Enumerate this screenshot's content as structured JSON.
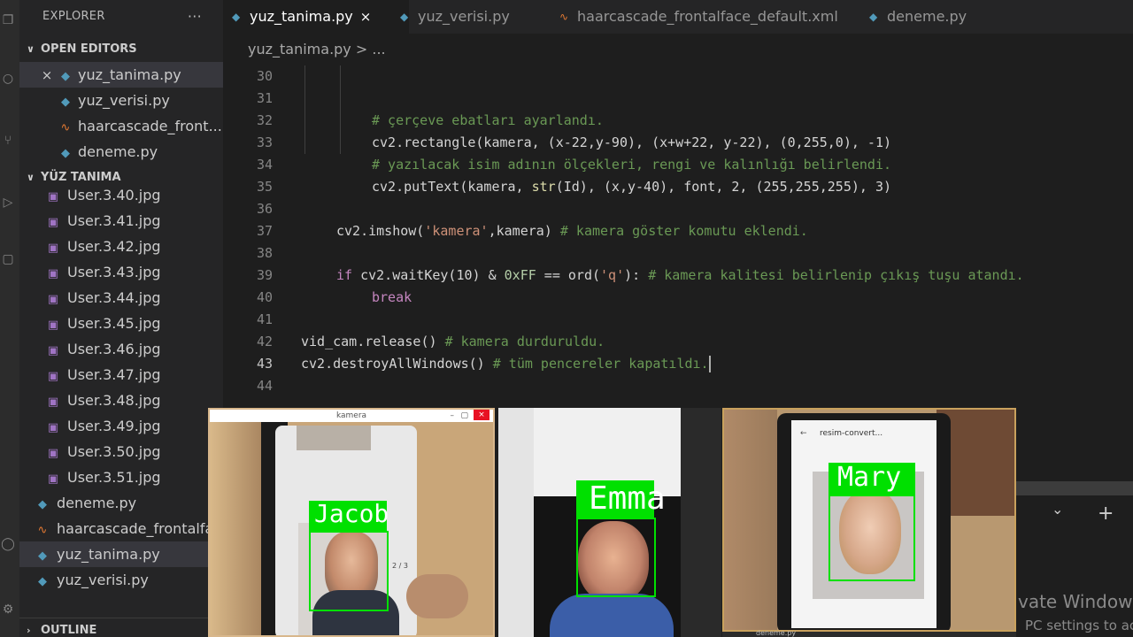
{
  "sidebar": {
    "title": "EXPLORER",
    "more": "···",
    "open_editors_label": "OPEN EDITORS",
    "open_editors": [
      {
        "name": "yuz_tanima.py",
        "kind": "py",
        "active": true
      },
      {
        "name": "yuz_verisi.py",
        "kind": "py"
      },
      {
        "name": "haarcascade_front...",
        "kind": "xml"
      },
      {
        "name": "deneme.py",
        "kind": "py"
      }
    ],
    "folder_label": "YÜZ TANIMA",
    "files": [
      {
        "name": "User.3.40.jpg",
        "kind": "img"
      },
      {
        "name": "User.3.41.jpg",
        "kind": "img"
      },
      {
        "name": "User.3.42.jpg",
        "kind": "img"
      },
      {
        "name": "User.3.43.jpg",
        "kind": "img"
      },
      {
        "name": "User.3.44.jpg",
        "kind": "img"
      },
      {
        "name": "User.3.45.jpg",
        "kind": "img"
      },
      {
        "name": "User.3.46.jpg",
        "kind": "img"
      },
      {
        "name": "User.3.47.jpg",
        "kind": "img"
      },
      {
        "name": "User.3.48.jpg",
        "kind": "img"
      },
      {
        "name": "User.3.49.jpg",
        "kind": "img"
      },
      {
        "name": "User.3.50.jpg",
        "kind": "img"
      },
      {
        "name": "User.3.51.jpg",
        "kind": "img"
      },
      {
        "name": "deneme.py",
        "kind": "py"
      },
      {
        "name": "haarcascade_frontalface",
        "kind": "xml"
      },
      {
        "name": "yuz_tanima.py",
        "kind": "py",
        "active": true
      },
      {
        "name": "yuz_verisi.py",
        "kind": "py"
      }
    ],
    "outline_label": "OUTLINE"
  },
  "tabs": [
    {
      "name": "yuz_tanima.py",
      "kind": "py",
      "active": true
    },
    {
      "name": "yuz_verisi.py",
      "kind": "py"
    },
    {
      "name": "haarcascade_frontalface_default.xml",
      "kind": "xml"
    },
    {
      "name": "deneme.py",
      "kind": "py"
    }
  ],
  "breadcrumb": {
    "file": "yuz_tanima.py",
    "sep": ">",
    "rest": "..."
  },
  "editor": {
    "current_line": "43",
    "lines": [
      {
        "n": "30",
        "segs": []
      },
      {
        "n": "31",
        "segs": []
      },
      {
        "n": "32",
        "indent": 2,
        "segs": [
          {
            "t": "# çerçeve ebatları ayarlandı.",
            "c": "cm"
          }
        ]
      },
      {
        "n": "33",
        "indent": 2,
        "segs": [
          {
            "t": "cv2.rectangle(kamera, (x-22,y-90), (x+w+22, y-22), (0,255,0), -1)"
          }
        ]
      },
      {
        "n": "34",
        "indent": 2,
        "segs": [
          {
            "t": "# yazılacak isim adının ölçekleri, rengi ve kalınlığı belirlendi.",
            "c": "cm"
          }
        ]
      },
      {
        "n": "35",
        "indent": 2,
        "segs": [
          {
            "t": "cv2.putText(kamera, "
          },
          {
            "t": "str",
            "c": "fn"
          },
          {
            "t": "(Id), (x,y-40), font, 2, (255,255,255), 3)"
          }
        ]
      },
      {
        "n": "36",
        "segs": []
      },
      {
        "n": "37",
        "indent": 1,
        "segs": [
          {
            "t": "cv2.imshow("
          },
          {
            "t": "'kamera'",
            "c": "str"
          },
          {
            "t": ",kamera) "
          },
          {
            "t": "# kamera göster komutu eklendi.",
            "c": "cm"
          }
        ]
      },
      {
        "n": "38",
        "segs": []
      },
      {
        "n": "39",
        "indent": 1,
        "segs": [
          {
            "t": "if",
            "c": "kw"
          },
          {
            "t": " cv2.waitKey(10) & "
          },
          {
            "t": "0xFF",
            "c": "hex"
          },
          {
            "t": " == ord("
          },
          {
            "t": "'q'",
            "c": "str"
          },
          {
            "t": "): "
          },
          {
            "t": "# kamera kalitesi belirlenip çıkış tuşu atandı.",
            "c": "cm"
          }
        ]
      },
      {
        "n": "40",
        "indent": 2,
        "segs": [
          {
            "t": "break",
            "c": "kw"
          }
        ]
      },
      {
        "n": "41",
        "segs": []
      },
      {
        "n": "42",
        "indent": 0,
        "segs": [
          {
            "t": "vid_cam.release() "
          },
          {
            "t": "# kamera durduruldu.",
            "c": "cm"
          }
        ]
      },
      {
        "n": "43",
        "indent": 0,
        "caret": true,
        "segs": [
          {
            "t": "cv2.destroyAllWindows() "
          },
          {
            "t": "# tüm pencereler kapatıldı.",
            "c": "cm"
          }
        ]
      },
      {
        "n": "44",
        "segs": []
      }
    ]
  },
  "camera_windows": {
    "window_title": "kamera",
    "names": [
      "Jacob",
      "Emma",
      "Mary"
    ],
    "phone_counter": "2 / 3",
    "phone_app_title": "resim-convert..."
  },
  "taskbar_item": "deneme.py",
  "activation_watermark": {
    "line1": "vate Windows",
    "line2": "PC settings to ac"
  },
  "colors": {
    "box": "#00e000",
    "accent": "#519aba"
  }
}
